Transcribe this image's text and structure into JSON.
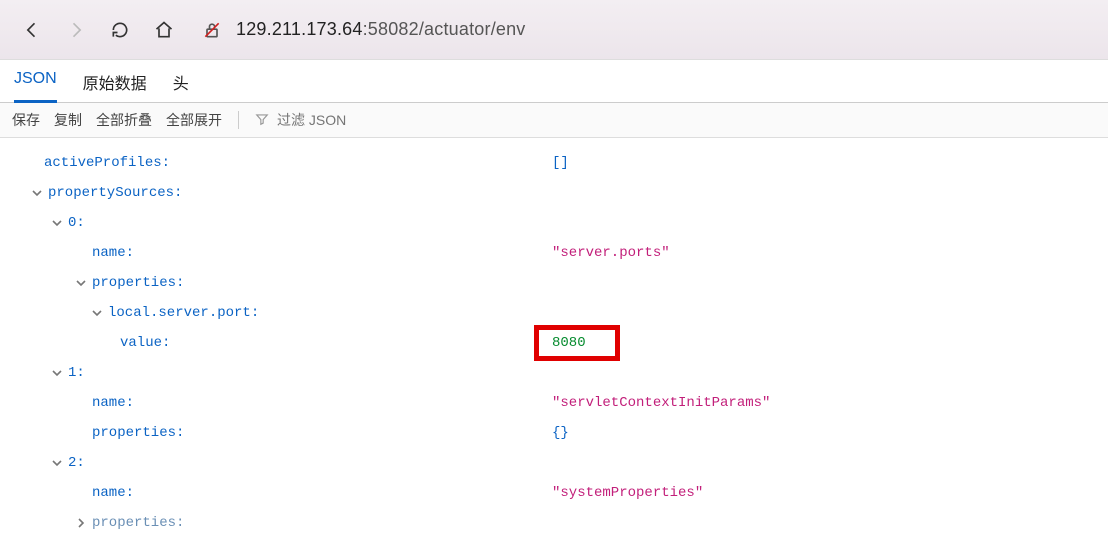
{
  "chrome": {
    "url_dark": "129.211.173.64",
    "url_rest": ":58082/actuator/env"
  },
  "tabs": {
    "json": "JSON",
    "raw": "原始数据",
    "headers": "头"
  },
  "toolbar": {
    "save": "保存",
    "copy": "复制",
    "collapse_all": "全部折叠",
    "expand_all": "全部展开",
    "filter_placeholder": "过滤 JSON"
  },
  "json": {
    "activeProfiles_key": "activeProfiles",
    "activeProfiles_val": "[]",
    "propertySources_key": "propertySources",
    "idx0": "0",
    "idx1": "1",
    "idx2": "2",
    "name_key": "name",
    "properties_key": "properties",
    "local_server_port_key": "local.server.port",
    "value_key": "value",
    "ps0_name": "\"server.ports\"",
    "ps0_port_value": "8080",
    "ps1_name": "\"servletContextInitParams\"",
    "ps1_properties": "{}",
    "ps2_name": "\"systemProperties\""
  }
}
